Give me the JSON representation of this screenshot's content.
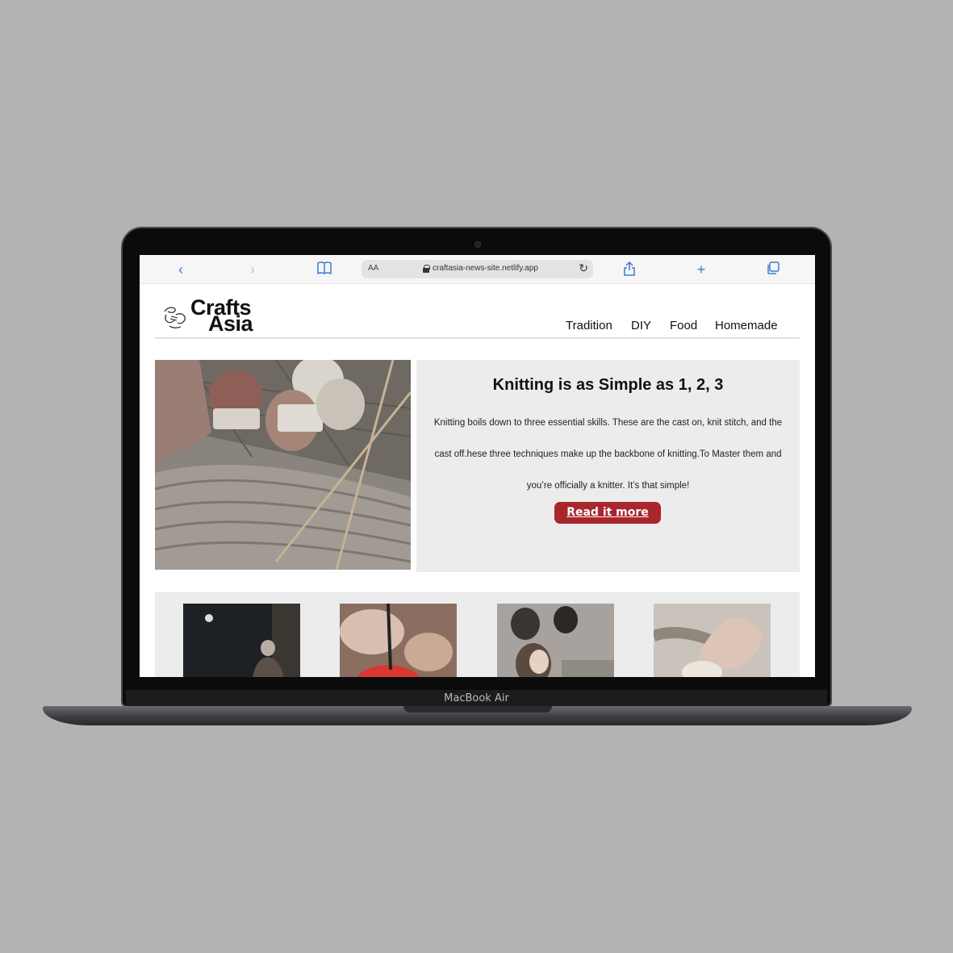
{
  "device": {
    "label": "MacBook Air"
  },
  "browser": {
    "text_size_label": "AA",
    "url": "craftasia-news-site.netlify.app"
  },
  "site": {
    "logo": {
      "line1": "Crafts",
      "line2": "Asia"
    },
    "nav": [
      "Tradition",
      "DIY",
      "Food",
      "Homemade"
    ]
  },
  "hero": {
    "title": "Knitting is as Simple as 1, 2, 3",
    "body": "Knitting boils down to three essential skills. These are the cast on, knit stitch, and the cast off.hese three techniques make up the backbone of knitting.To Master them and you’re officially a knitter. It’s that simple!",
    "button": "Read it more"
  },
  "colors": {
    "accent": "#a8262c",
    "panel": "#ececec",
    "backdrop": "#b3b3b3"
  }
}
